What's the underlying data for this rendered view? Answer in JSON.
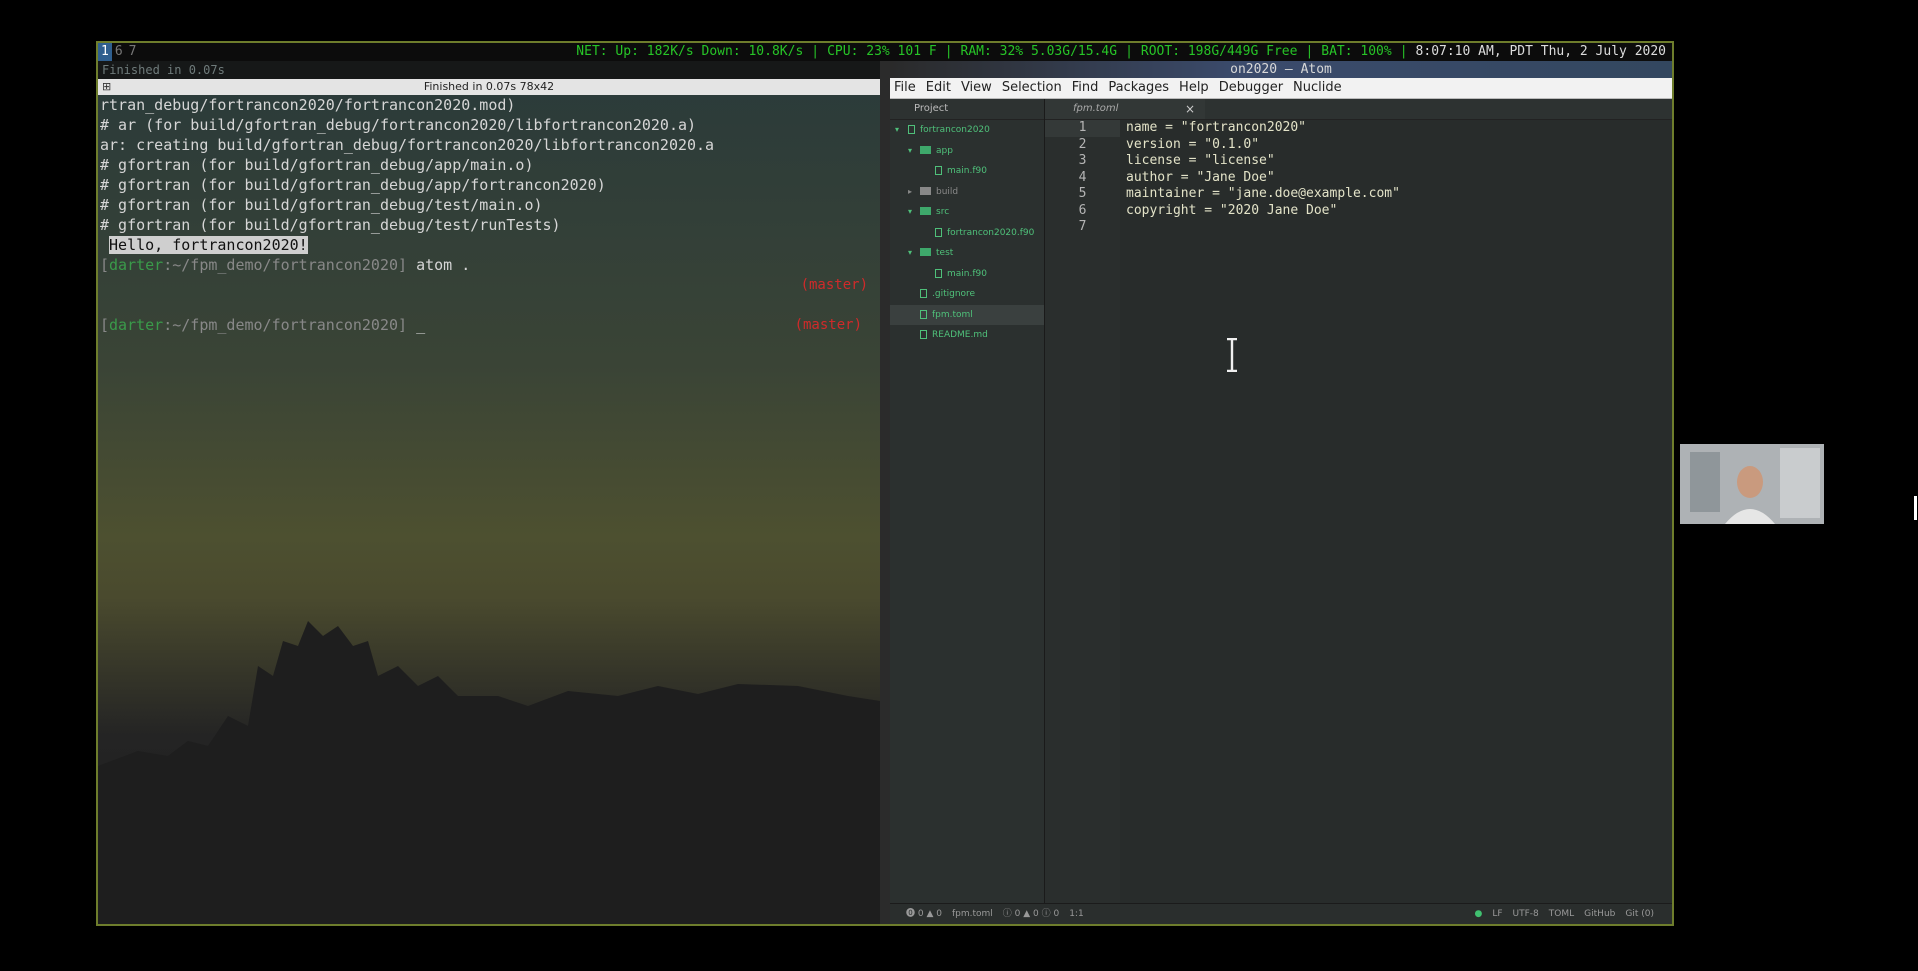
{
  "statusbar": {
    "workspaces": [
      "1",
      "6",
      "7"
    ],
    "net": "NET: Up: 182K/s Down: 10.8K/s",
    "cpu": "CPU: 23% 101 F",
    "ram": "RAM: 32% 5.03G/15.4G",
    "root": "ROOT: 198G/449G Free",
    "bat": "BAT: 100%",
    "clock": "8:07:10 AM, PDT Thu,  2 July 2020"
  },
  "terminal": {
    "topline": "Finished in 0.07s",
    "title": "Finished in 0.07s 78x42",
    "lines": [
      "rtran_debug/fortrancon2020/fortrancon2020.mod)",
      "# ar (for build/gfortran_debug/fortrancon2020/libfortrancon2020.a)",
      "ar: creating build/gfortran_debug/fortrancon2020/libfortrancon2020.a",
      "# gfortran (for build/gfortran_debug/app/main.o)",
      "# gfortran (for build/gfortran_debug/app/fortrancon2020)",
      "# gfortran (for build/gfortran_debug/test/main.o)",
      "# gfortran (for build/gfortran_debug/test/runTests)"
    ],
    "hello": "Hello, fortrancon2020!",
    "prompt_user": "darter",
    "prompt_path": ":~/fpm_demo/fortrancon2020",
    "command1": "atom .",
    "branch": "(master)",
    "cursor": "_"
  },
  "atom": {
    "title": "on2020 — Atom",
    "menu": [
      "File",
      "Edit",
      "View",
      "Selection",
      "Find",
      "Packages",
      "Help",
      "Debugger",
      "Nuclide"
    ],
    "tree_header": "Project",
    "tree": {
      "root": "fortrancon2020",
      "app": "app",
      "app_main": "main.f90",
      "build": "build",
      "src": "src",
      "src_file": "fortrancon2020.f90",
      "test": "test",
      "test_main": "main.f90",
      "gitignore": ".gitignore",
      "fpm": "fpm.toml",
      "readme": "README.md"
    },
    "tab": {
      "label": "fpm.toml",
      "close": "×"
    },
    "line_numbers": [
      "1",
      "2",
      "3",
      "4",
      "5",
      "6",
      "7"
    ],
    "code": [
      "name = \"fortrancon2020\"",
      "version = \"0.1.0\"",
      "license = \"license\"",
      "author = \"Jane Doe\"",
      "maintainer = \"jane.doe@example.com\"",
      "copyright = \"2020 Jane Doe\"",
      ""
    ],
    "footer": {
      "left": [
        "⓿ 0 ▲ 0",
        "fpm.toml",
        "ⓘ 0 ▲ 0 ⓘ 0",
        "1:1"
      ],
      "right": [
        "LF",
        "UTF-8",
        "TOML",
        "GitHub",
        "Git (0)"
      ]
    }
  }
}
